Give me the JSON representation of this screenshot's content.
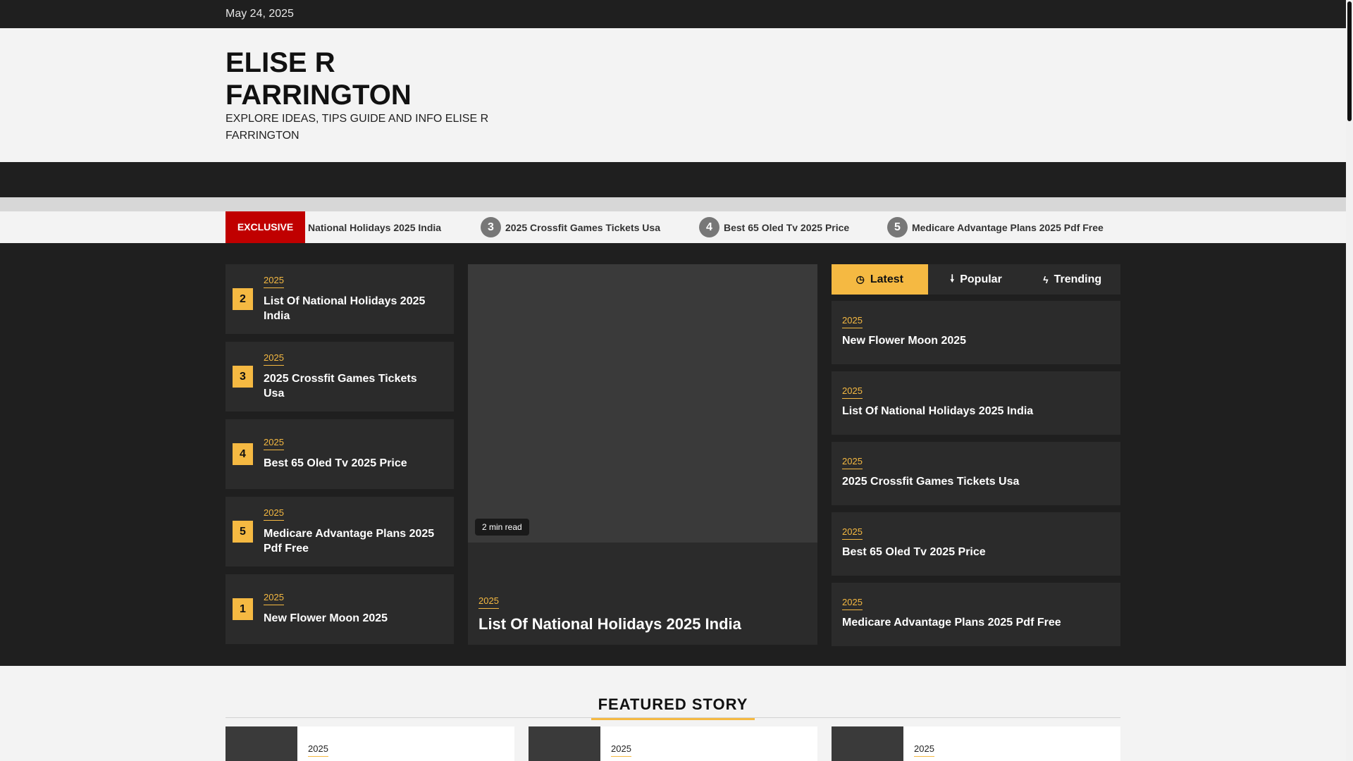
{
  "topbar": {
    "date": "May 24, 2025"
  },
  "header": {
    "title": "ELISE R FARRINGTON",
    "description": "EXPLORE IDEAS, TIPS GUIDE AND INFO ELISE R FARRINGTON"
  },
  "ticker": {
    "label": "EXCLUSIVE",
    "items": [
      {
        "num": "",
        "title": "National Holidays 2025 India"
      },
      {
        "num": "3",
        "title": "2025 Crossfit Games Tickets Usa"
      },
      {
        "num": "4",
        "title": "Best 65 Oled Tv 2025 Price"
      },
      {
        "num": "5",
        "title": "Medicare Advantage Plans 2025 Pdf Free"
      }
    ]
  },
  "left_list": [
    {
      "num": "2",
      "category": "2025",
      "title": "List Of National Holidays 2025 India"
    },
    {
      "num": "3",
      "category": "2025",
      "title": "2025 Crossfit Games Tickets Usa"
    },
    {
      "num": "4",
      "category": "2025",
      "title": "Best 65 Oled Tv 2025 Price"
    },
    {
      "num": "5",
      "category": "2025",
      "title": "Medicare Advantage Plans 2025 Pdf Free"
    },
    {
      "num": "1",
      "category": "2025",
      "title": "New Flower Moon 2025"
    }
  ],
  "feature": {
    "read_time": "2 min read",
    "category": "2025",
    "title": "List Of National Holidays 2025 India"
  },
  "tabs": [
    {
      "label": "Latest",
      "icon": "clock-icon",
      "glyph": "◷"
    },
    {
      "label": "Popular",
      "icon": "flame-icon",
      "glyph": "🠗"
    },
    {
      "label": "Trending",
      "icon": "bolt-icon",
      "glyph": "ϟ"
    }
  ],
  "right_list": [
    {
      "category": "2025",
      "title": "New Flower Moon 2025"
    },
    {
      "category": "2025",
      "title": "List Of National Holidays 2025 India"
    },
    {
      "category": "2025",
      "title": "2025 Crossfit Games Tickets Usa"
    },
    {
      "category": "2025",
      "title": "Best 65 Oled Tv 2025 Price"
    },
    {
      "category": "2025",
      "title": "Medicare Advantage Plans 2025 Pdf Free"
    }
  ],
  "featured": {
    "heading": "FEATURED STORY",
    "cards": [
      {
        "category": "2025"
      },
      {
        "category": "2025"
      },
      {
        "category": "2025"
      }
    ]
  },
  "colors": {
    "accent": "#f5b942",
    "exclusive": "#c00000",
    "dark": "#1f1f1f",
    "card": "#2b2b2b"
  }
}
